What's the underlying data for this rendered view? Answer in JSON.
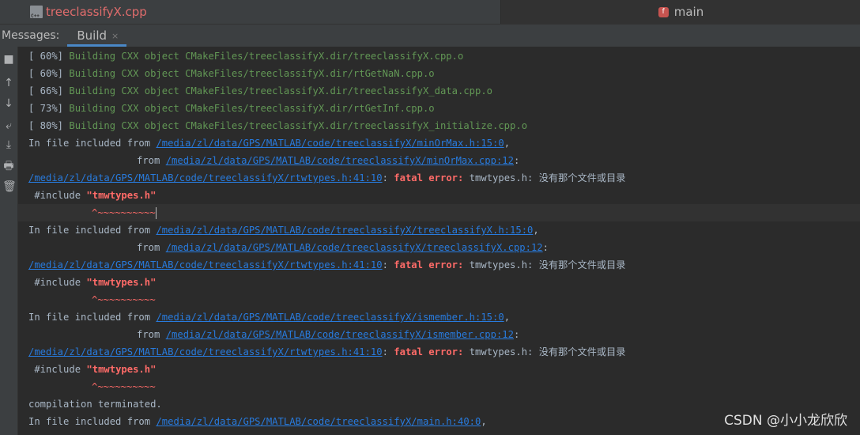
{
  "tabs": {
    "left": {
      "label": "treeclassifyX.cpp",
      "icon": "cpp-file-icon"
    },
    "right": {
      "label": "main",
      "icon": "function-icon"
    }
  },
  "messages": {
    "title": "Messages:",
    "tab_label": "Build",
    "close": "×"
  },
  "toolbar": {
    "stop": "■",
    "up": "↑",
    "down": "↓",
    "wrap": "⤶",
    "scroll_end": "⤓",
    "print": "🖶",
    "trash": "🗑"
  },
  "console": {
    "build_lines": [
      {
        "pct": "[ 60%]",
        "text": "Building CXX object CMakeFiles/treeclassifyX.dir/treeclassifyX.cpp.o"
      },
      {
        "pct": "[ 60%]",
        "text": "Building CXX object CMakeFiles/treeclassifyX.dir/rtGetNaN.cpp.o"
      },
      {
        "pct": "[ 66%]",
        "text": "Building CXX object CMakeFiles/treeclassifyX.dir/treeclassifyX_data.cpp.o"
      },
      {
        "pct": "[ 73%]",
        "text": "Building CXX object CMakeFiles/treeclassifyX.dir/rtGetInf.cpp.o"
      },
      {
        "pct": "[ 80%]",
        "text": "Building CXX object CMakeFiles/treeclassifyX.dir/treeclassifyX_initialize.cpp.o"
      }
    ],
    "in_file": "In file included from",
    "from": "from",
    "comma": ",",
    "colon": ":",
    "fatal": "fatal error:",
    "msg": "tmwtypes.h: 没有那个文件或目录",
    "include_kw": "#include",
    "include_file": "\"tmwtypes.h\"",
    "squiggle": "^~~~~~~~~~~",
    "errors": [
      {
        "included": "/media/zl/data/GPS/MATLAB/code/treeclassifyX/minOrMax.h:15:0",
        "from": "/media/zl/data/GPS/MATLAB/code/treeclassifyX/minOrMax.cpp:12",
        "error_loc": "/media/zl/data/GPS/MATLAB/code/treeclassifyX/rtwtypes.h:41:10"
      },
      {
        "included": "/media/zl/data/GPS/MATLAB/code/treeclassifyX/treeclassifyX.h:15:0",
        "from": "/media/zl/data/GPS/MATLAB/code/treeclassifyX/treeclassifyX.cpp:12",
        "error_loc": "/media/zl/data/GPS/MATLAB/code/treeclassifyX/rtwtypes.h:41:10"
      },
      {
        "included": "/media/zl/data/GPS/MATLAB/code/treeclassifyX/ismember.h:15:0",
        "from": "/media/zl/data/GPS/MATLAB/code/treeclassifyX/ismember.cpp:12",
        "error_loc": "/media/zl/data/GPS/MATLAB/code/treeclassifyX/rtwtypes.h:41:10"
      }
    ],
    "terminated": "compilation terminated.",
    "last_included": "/media/zl/data/GPS/MATLAB/code/treeclassifyX/main.h:40:0"
  },
  "watermark": "CSDN @小小龙欣欣",
  "colors": {
    "background": "#2b2b2b",
    "green": "#629755",
    "link": "#287bde",
    "error": "#ff6b68",
    "accent": "#4a88c7"
  }
}
